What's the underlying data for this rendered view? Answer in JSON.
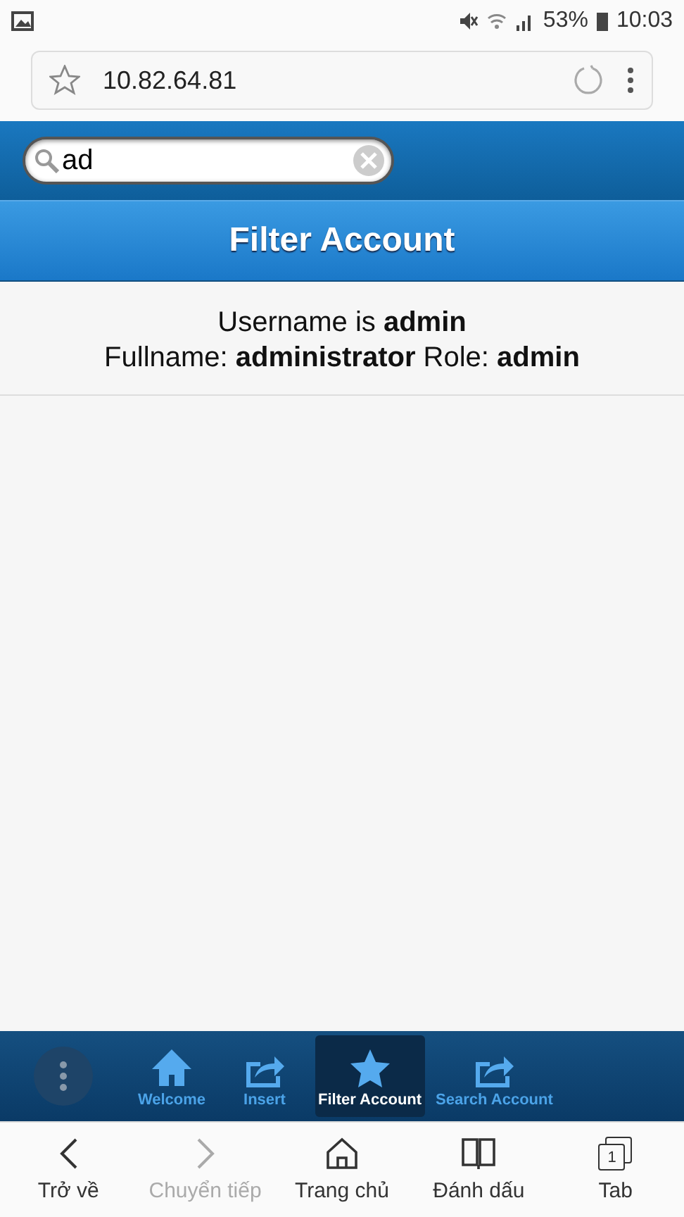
{
  "status_bar": {
    "battery": "53%",
    "time": "10:03"
  },
  "browser": {
    "url": "10.82.64.81"
  },
  "search": {
    "value": "ad"
  },
  "header": {
    "title": "Filter Account"
  },
  "results": [
    {
      "line1": "Username is **admin**",
      "line2": "Fullname: **administrator** Role: **admin**"
    }
  ],
  "navbar": [
    {
      "label": "Welcome",
      "selected": false
    },
    {
      "label": "Insert",
      "selected": false
    },
    {
      "label": "Filter Account",
      "selected": true
    },
    {
      "label": "Search Account",
      "selected": false
    }
  ],
  "browser_toolbar": [
    {
      "label": "Trở về",
      "disabled": false
    },
    {
      "label": "Chuyển tiếp",
      "disabled": true
    },
    {
      "label": "Trang chủ",
      "disabled": false
    },
    {
      "label": "Đánh dấu",
      "disabled": false
    },
    {
      "label": "Tab",
      "disabled": false,
      "count": "1"
    }
  ]
}
